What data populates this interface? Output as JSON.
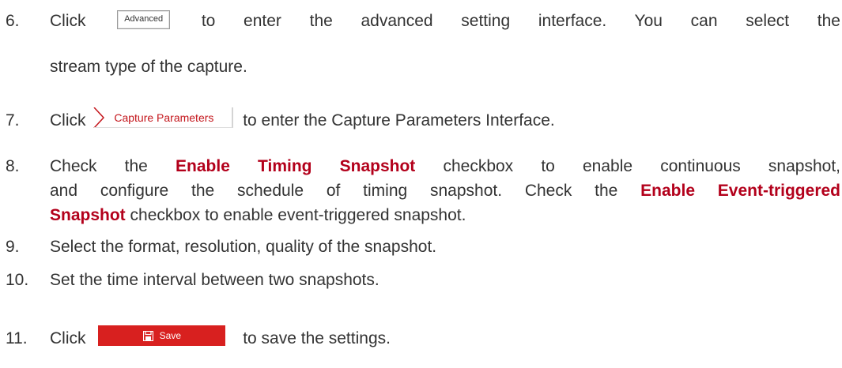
{
  "steps": [
    {
      "number": "6.",
      "pre": "Click",
      "button_label": "Advanced",
      "line1_rest": "to enter the advanced setting interface. You can select the",
      "line2": "stream type of the capture."
    },
    {
      "number": "7.",
      "pre": "Click",
      "tab_label": "Capture Parameters",
      "rest": "to enter the Capture Parameters Interface."
    },
    {
      "number": "8.",
      "pre": "Check the",
      "bold1": "Enable Timing Snapshot",
      "line1_rest": "checkbox to enable continuous snapshot,",
      "line2_pre": "and configure the schedule of timing snapshot. Check the",
      "bold2a": "Enable Event-triggered",
      "bold2b": "Snapshot",
      "line3_rest": "checkbox to enable event-triggered snapshot."
    },
    {
      "number": "9.",
      "text": "Select the format, resolution, quality of the snapshot."
    },
    {
      "number": "10.",
      "text": "Set the time interval between two snapshots."
    },
    {
      "number": "11.",
      "pre": "Click",
      "button_label": "Save",
      "rest": "to save the settings."
    }
  ],
  "colors": {
    "text": "#333333",
    "emphasis": "#b3001b",
    "save_button": "#d8201f",
    "tab_accent": "#c4161c"
  },
  "icons": {
    "save": "save-icon",
    "tab_arrow": "chevron-right-icon"
  }
}
